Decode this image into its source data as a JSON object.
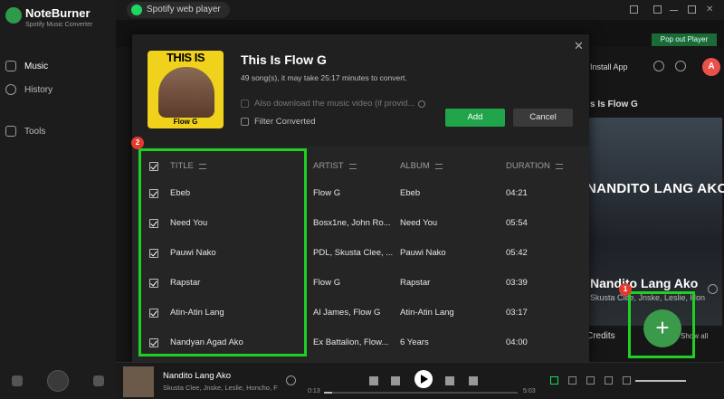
{
  "app": {
    "name": "NoteBurner",
    "subtitle": "Spotify Music Converter"
  },
  "sidebar": {
    "items": [
      {
        "label": "Music",
        "icon": "headphones-icon",
        "active": true
      },
      {
        "label": "History",
        "icon": "clock-icon",
        "active": false
      },
      {
        "label": "Tools",
        "icon": "toolbox-icon",
        "active": false
      }
    ]
  },
  "topbar": {
    "tab_label": "Spotify web player",
    "popout_label": "Pop out Player"
  },
  "background": {
    "install_app": "Install App",
    "section_title": "s Is Flow G",
    "banner_text": "NANDITO LANG AKO",
    "song_name": "Nandito Lang Ako",
    "song_artists": "Skusta Clee, Jnske, Leslie, Hon",
    "credits": "Credits",
    "show_all": "Show all",
    "user_initial": "A"
  },
  "dialog": {
    "title": "This Is Flow G",
    "subtitle": "49 song(s), it may take 25:17 minutes to convert.",
    "cover_top_text": "THIS IS",
    "cover_name": "Flow G",
    "option_video": "Also download the music video (if provid...",
    "option_filter": "Filter Converted",
    "add_label": "Add",
    "cancel_label": "Cancel",
    "columns": {
      "title": "TITLE",
      "artist": "ARTIST",
      "album": "ALBUM",
      "duration": "DURATION"
    },
    "rows": [
      {
        "title": "Ebeb",
        "artist": "Flow G",
        "album": "Ebeb",
        "duration": "04:21"
      },
      {
        "title": "Need You",
        "artist": "Bosx1ne, John Ro...",
        "album": "Need You",
        "duration": "05:54"
      },
      {
        "title": "Pauwi Nako",
        "artist": "PDL, Skusta Clee, ...",
        "album": "Pauwi Nako",
        "duration": "05:42"
      },
      {
        "title": "Rapstar",
        "artist": "Flow G",
        "album": "Rapstar",
        "duration": "03:39"
      },
      {
        "title": "Atin-Atin Lang",
        "artist": "Al James, Flow G",
        "album": "Atin-Atin Lang",
        "duration": "03:17"
      },
      {
        "title": "Nandyan Agad Ako",
        "artist": "Ex Battalion, Flow...",
        "album": "6 Years",
        "duration": "04:00"
      }
    ]
  },
  "annotations": {
    "badge_1": "1",
    "badge_2": "2"
  },
  "player": {
    "track_title": "Nandito Lang Ako",
    "track_artists": "Skusta Clee, Jnske, Leslie, Honcho, F",
    "time_current": "0:13",
    "time_total": "5:03",
    "progress": 0.04
  },
  "colors": {
    "accent": "#21a34a",
    "highlight_frame": "#1fcf24",
    "badge": "#e13a2f"
  }
}
